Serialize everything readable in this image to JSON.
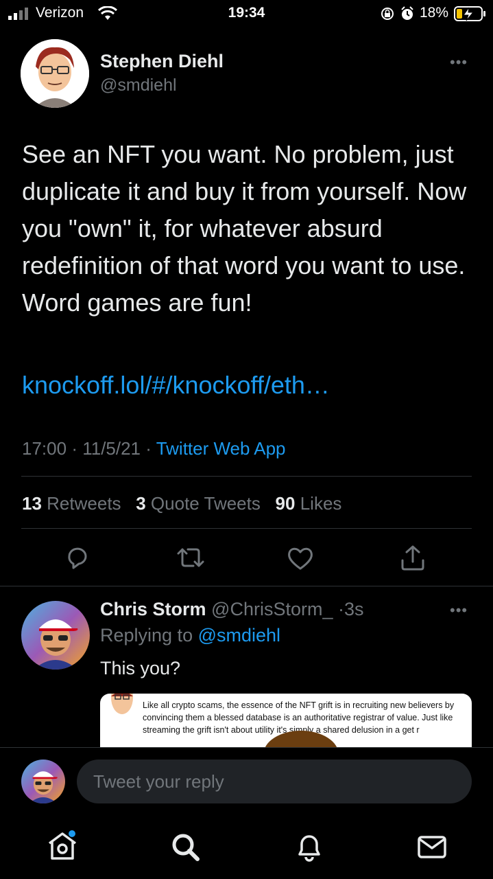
{
  "status_bar": {
    "carrier": "Verizon",
    "time": "19:34",
    "battery_percent": "18%"
  },
  "tweet": {
    "author_name": "Stephen Diehl",
    "author_handle": "@smdiehl",
    "text": "See an NFT you want. No problem, just duplicate it and buy it from yourself. Now you \"own\" it, for whatever absurd redefinition of that word you want to use. Word games are fun!",
    "link": "knockoff.lol/#/knockoff/eth…",
    "time": "17:00",
    "date": "11/5/21",
    "source": "Twitter Web App",
    "more_icon": "•••",
    "stats": {
      "retweets_count": "13",
      "retweets_label": "Retweets",
      "quotes_count": "3",
      "quotes_label": "Quote Tweets",
      "likes_count": "90",
      "likes_label": "Likes"
    }
  },
  "reply": {
    "author_name": "Chris Storm",
    "author_handle": "@ChrisStorm_",
    "age": "3s",
    "replying_prefix": "Replying to",
    "replying_to": "@smdiehl",
    "text": "This you?",
    "quoted_text": "Like all crypto scams, the essence of the NFT grift is in recruiting new believers by convincing them a blessed database is an authoritative registrar of value. Just like streaming the grift isn't about utility it's simply a shared delusion in a get r"
  },
  "reply_bar": {
    "placeholder": "Tweet your reply"
  },
  "tabs": [
    "home",
    "search",
    "notifications",
    "messages"
  ],
  "colors": {
    "background": "#000000",
    "accent": "#1d9bf0",
    "secondary_text": "#71767b",
    "divider": "#2f3336"
  }
}
